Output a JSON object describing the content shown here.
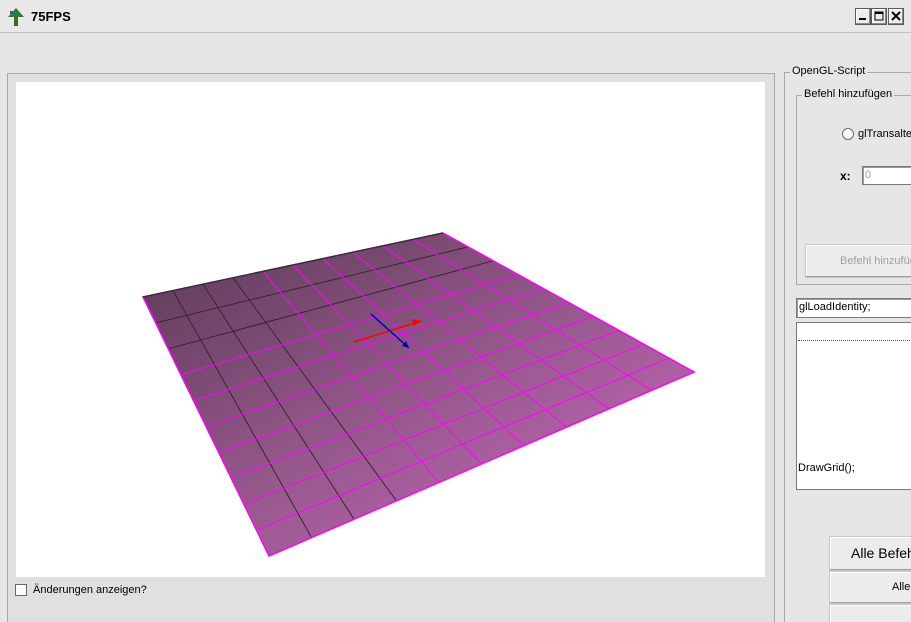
{
  "window": {
    "title": "75FPS",
    "app_icon": "app-tree-icon",
    "controls": [
      "minimize-icon",
      "maximize-icon",
      "close-icon"
    ]
  },
  "viewport": {
    "show_changes_label": "Änderungen anzeigen?",
    "show_changes_checked": false,
    "scene": {
      "grid_color": "#ff00ff",
      "axis_x_color": "#ff0000",
      "axis_y_color": "#0000ff"
    }
  },
  "script_panel": {
    "group_label": "OpenGL-Script",
    "add_command": {
      "group_label": "Befehl hinzufügen",
      "radio_label": "glTransalte",
      "x_label": "x:",
      "x_value": "0",
      "add_button_label": "Befehl hinzufügen"
    },
    "command_input": "glLoadIdentity;",
    "command_list_footer": "DrawGrid();",
    "buttons": {
      "all_commands_label": "Alle Befehle",
      "second_label": "Alle",
      "third_label": ""
    }
  }
}
